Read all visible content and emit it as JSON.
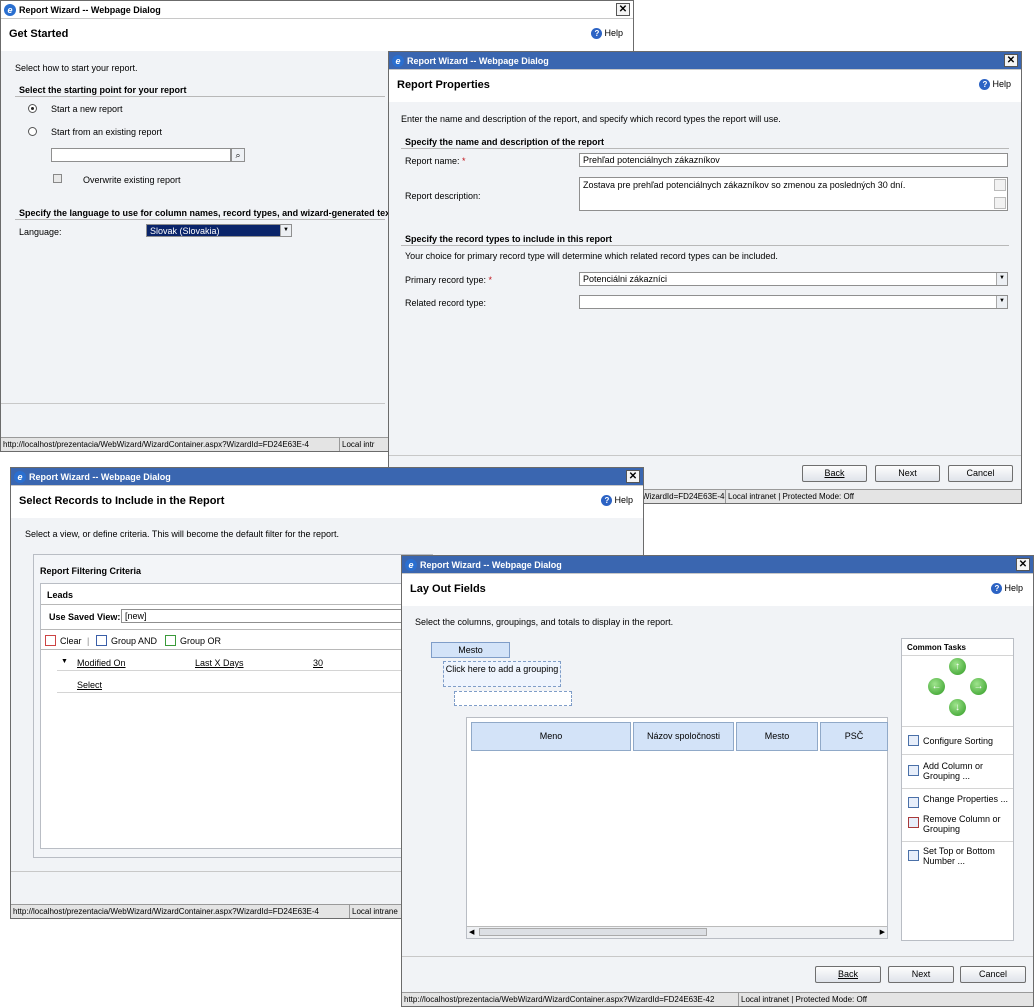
{
  "dialog_title": "Report Wizard -- Webpage Dialog",
  "help_label": "Help",
  "statusbar": {
    "url": "http://localhost/prezentacia/WebWizard/WizardContainer.aspx?WizardId=FD24E63E-42",
    "url_short": "http://localhost/prezentacia/WebWizard/WizardContainer.aspx?WizardId=FD24E63E-4",
    "url_fragment": "WizardId=FD24E63E-4",
    "zone_short": "Local intr",
    "zone_mid": "Local intrane",
    "zone_full": "Local intranet | Protected Mode: Off"
  },
  "buttons": {
    "back": "Back",
    "next": "Next",
    "cancel": "Cancel"
  },
  "get_started": {
    "header": "Get Started",
    "intro": "Select how to start your report.",
    "starting_point_heading": "Select the starting point for your report",
    "option_new": "Start a new report",
    "option_existing": "Start from an existing report",
    "existing_report_value": "",
    "overwrite_label": "Overwrite existing report",
    "language_heading": "Specify the language to use for column names, record types, and wizard-generated text",
    "language_label": "Language:",
    "language_value": "Slovak (Slovakia)"
  },
  "report_properties": {
    "header": "Report Properties",
    "intro": "Enter the name and description of the report, and specify which record types the report will use.",
    "name_section": "Specify the name and description of the report",
    "report_name_label": "Report name:",
    "report_name_value": "Prehľad potenciálnych zákazníkov",
    "report_description_label": "Report description:",
    "report_description_value": "Zostava pre prehľad potenciálnych zákazníkov so zmenou za posledných 30 dní.",
    "record_types_section": "Specify the record types to include in this report",
    "record_types_note": "Your choice for primary record type will determine which related record types can be included.",
    "primary_label": "Primary record type:",
    "primary_value": "Potenciálni zákazníci",
    "related_label": "Related record type:",
    "related_value": "",
    "required_mark": "*"
  },
  "select_records": {
    "header": "Select Records to Include in the Report",
    "intro": "Select a view, or define criteria. This will become the default filter for the report.",
    "criteria_title": "Report Filtering Criteria",
    "entity": "Leads",
    "saved_view_label": "Use Saved View:",
    "saved_view_value": "[new]",
    "toolbar": {
      "clear": "Clear",
      "group_and": "Group AND",
      "group_or": "Group OR"
    },
    "condition": {
      "field": "Modified On",
      "operator": "Last X Days",
      "value": "30"
    },
    "select_link": "Select"
  },
  "layout_fields": {
    "header": "Lay Out Fields",
    "intro": "Select the columns, groupings, and totals to display in the report.",
    "grouping_field": "Mesto",
    "add_grouping": "Click here to add a grouping",
    "columns": [
      "Meno",
      "Názov spoločnosti",
      "Mesto",
      "PSČ"
    ],
    "common_tasks_title": "Common Tasks",
    "tasks": {
      "configure_sorting": "Configure Sorting",
      "add_column": "Add Column or Grouping ...",
      "change_properties": "Change Properties ...",
      "remove_column": "Remove Column or Grouping",
      "set_top": "Set Top or Bottom Number ..."
    }
  }
}
